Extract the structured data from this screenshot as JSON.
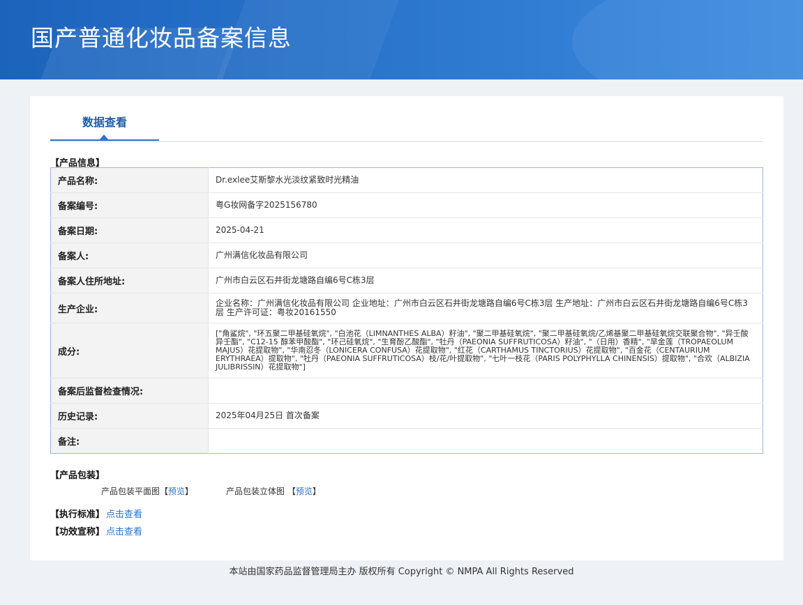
{
  "header": {
    "title": "国产普通化妆品备案信息"
  },
  "tabs": [
    {
      "label": "数据查看"
    }
  ],
  "product_info": {
    "section_label": "【产品信息】",
    "rows": [
      {
        "key": "产品名称:",
        "value": "Dr.exlee艾斯黎水光淡纹紧致时光精油"
      },
      {
        "key": "备案编号:",
        "value": "粤G妆网备字2025156780"
      },
      {
        "key": "备案日期:",
        "value": "2025-04-21"
      },
      {
        "key": "备案人:",
        "value": "广州满信化妆品有限公司"
      },
      {
        "key": "备案人住所地址:",
        "value": "广州市白云区石井街龙塘路自编6号C栋3层"
      },
      {
        "key": "生产企业:",
        "value": "企业名称：广州满信化妆品有限公司 企业地址：广州市白云区石井街龙塘路自编6号C栋3层 生产地址：广州市白云区石井街龙塘路自编6号C栋3层 生产许可证：粤妆20161550"
      },
      {
        "key": "成分:",
        "value": "[\"角鲨烷\", \"环五聚二甲基硅氧烷\", \"白池花（LIMNANTHES ALBA）籽油\", \"聚二甲基硅氧烷\", \"聚二甲基硅氧烷/乙烯基聚二甲基硅氧烷交联聚合物\", \"异壬酸异壬酯\", \"C12-15 醇苯甲酸酯\", \"环己硅氧烷\", \"生育酚乙酸酯\", \"牡丹（PAEONIA SUFFRUTICOSA）籽油\", \"（日用）香精\", \"旱金莲（TROPAEOLUM MAJUS）花提取物\", \"华南忍冬（LONICERA CONFUSA）花提取物\", \"红花（CARTHAMUS TINCTORIUS）花提取物\", \"百金花（CENTAURIUM ERYTHRAEA）提取物\", \"牡丹（PAEONIA SUFFRUTICOSA）枝/花/叶提取物\", \"七叶一枝花（PARIS POLYPHYLLA CHINENSIS）提取物\", \"合欢（ALBIZIA JULIBRISSIN）花提取物\"]"
      },
      {
        "key": "备案后监督检查情况:",
        "value": ""
      },
      {
        "key": "历史记录:",
        "value": "2025年04月25日 首次备案"
      },
      {
        "key": "备注:",
        "value": ""
      }
    ]
  },
  "packaging": {
    "section_label": "【产品包装】",
    "flat_label": "产品包装平面图",
    "flat_link": "预览",
    "solid_label": "产品包装立体图",
    "solid_link": "预览"
  },
  "standard": {
    "section_label": "【执行标准】",
    "link": "点击查看"
  },
  "efficacy": {
    "section_label": "【功效宣称】",
    "link": "点击查看"
  },
  "footer": {
    "text": "本站由国家药品监督管理局主办 版权所有 Copyright © NMPA All Rights Reserved"
  }
}
